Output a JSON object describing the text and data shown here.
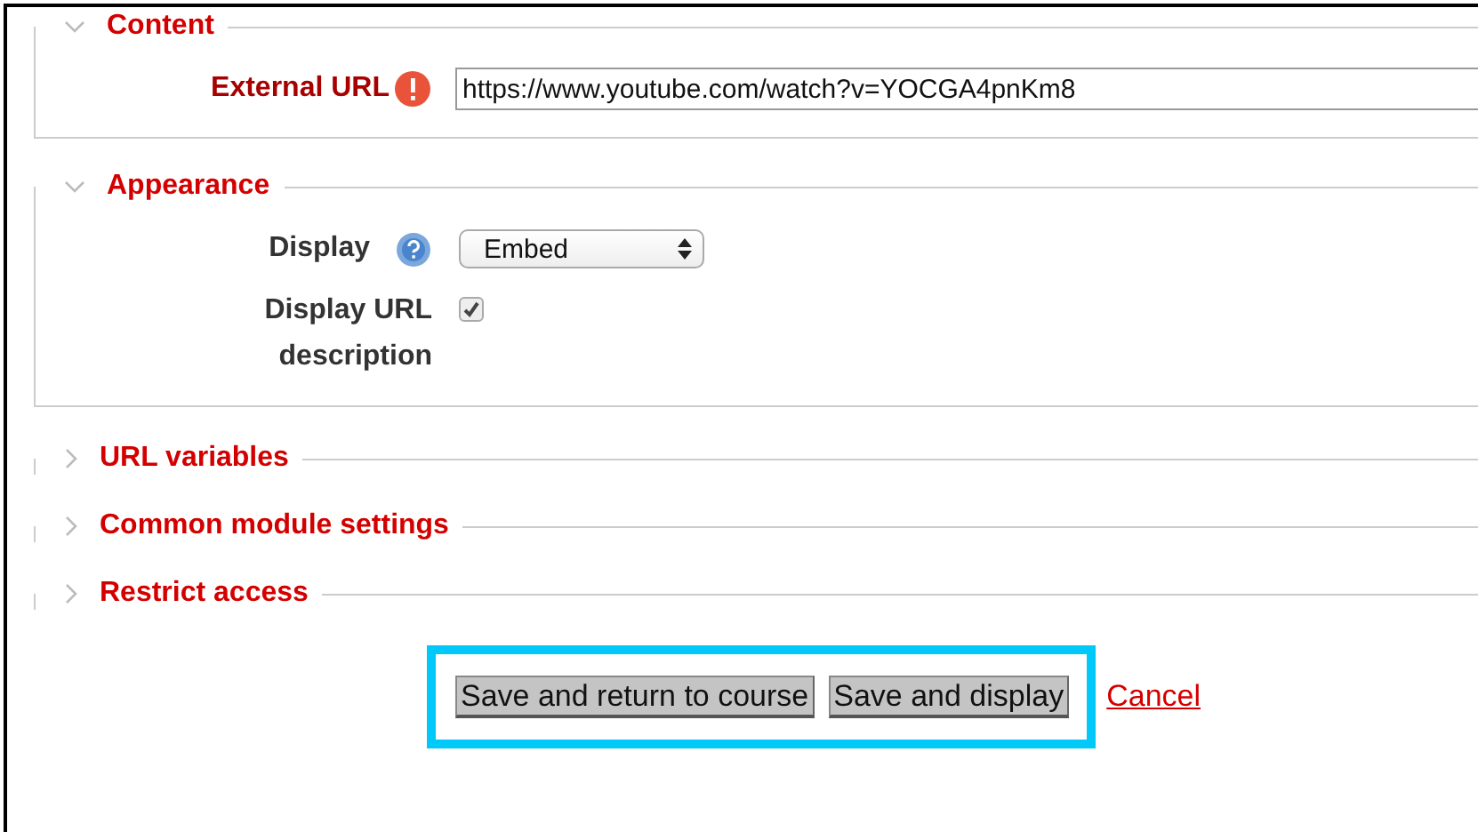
{
  "sections": [
    {
      "title": "Content",
      "expanded": true,
      "fields": [
        {
          "kind": "text",
          "label": "External URL",
          "required": true,
          "help": false,
          "value": "https://www.youtube.com/watch?v=YOCGA4pnKm8"
        }
      ]
    },
    {
      "title": "Appearance",
      "expanded": true,
      "fields": [
        {
          "kind": "select",
          "label": "Display",
          "required": false,
          "help": true,
          "value": "Embed"
        },
        {
          "kind": "checkbox",
          "label": "Display URL description",
          "required": false,
          "help": false,
          "checked": true
        }
      ]
    },
    {
      "title": "URL variables",
      "expanded": false
    },
    {
      "title": "Common module settings",
      "expanded": false
    },
    {
      "title": "Restrict access",
      "expanded": false
    }
  ],
  "actions": {
    "highlighted": true,
    "buttons": [
      "Save and return to course",
      "Save and display"
    ],
    "cancel_link": "Cancel"
  }
}
